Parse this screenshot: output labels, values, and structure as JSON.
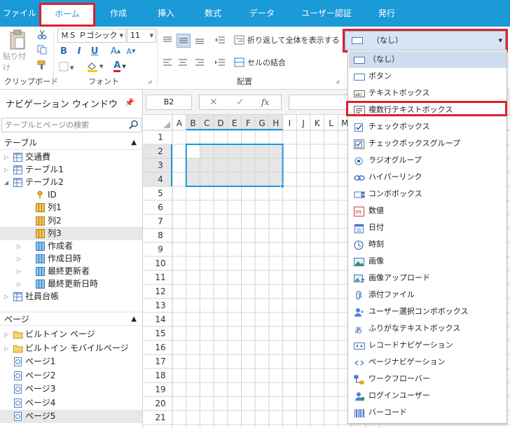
{
  "menu": {
    "items": [
      "ファイル",
      "ホーム",
      "作成",
      "挿入",
      "数式",
      "データ",
      "ユーザー認証",
      "発行"
    ],
    "active_index": 1
  },
  "ribbon": {
    "clipboard": {
      "paste_label": "貼り付け",
      "group_label": "クリップボード"
    },
    "font": {
      "family": "ＭＳ Ｐゴシック",
      "size": "11",
      "group_label": "フォント",
      "bold": "B",
      "italic": "I",
      "underline": "U",
      "grow": "A",
      "shrink": "A",
      "font_color_letter": "A"
    },
    "alignment": {
      "wrap_label": "折り返して全体を表示する",
      "merge_label": "セルの結合",
      "group_label": "配置"
    },
    "control_type": {
      "selected": "（なし）"
    }
  },
  "colors": {
    "accent": "#1a9ad6",
    "highlight_red": "#e0202a",
    "fill_yellow": "#f2d100",
    "font_red": "#e02020",
    "selection": "#cfdcf0"
  },
  "nav": {
    "title": "ナビゲーション ウィンドウ",
    "search_placeholder": "テーブルとページの検索",
    "tables_header": "テーブル",
    "pages_header": "ページ",
    "tables": [
      {
        "label": "交通費",
        "level": 0,
        "twisty": "▷",
        "icon": "table-icon"
      },
      {
        "label": "テーブル1",
        "level": 0,
        "twisty": "▷",
        "icon": "table-icon"
      },
      {
        "label": "テーブル2",
        "level": 0,
        "twisty": "◢",
        "icon": "table-icon"
      },
      {
        "label": "ID",
        "level": 1,
        "twisty": "",
        "icon": "key-icon"
      },
      {
        "label": "列1",
        "level": 1,
        "twisty": "",
        "icon": "column-icon"
      },
      {
        "label": "列2",
        "level": 1,
        "twisty": "",
        "icon": "column-icon"
      },
      {
        "label": "列3",
        "level": 1,
        "twisty": "",
        "icon": "column-icon",
        "selected": true
      },
      {
        "label": "作成者",
        "level": 1,
        "twisty": "▷",
        "icon": "system-column-icon"
      },
      {
        "label": "作成日時",
        "level": 1,
        "twisty": "▷",
        "icon": "system-column-icon"
      },
      {
        "label": "最終更新者",
        "level": 1,
        "twisty": "▷",
        "icon": "system-column-icon"
      },
      {
        "label": "最終更新日時",
        "level": 1,
        "twisty": "▷",
        "icon": "system-column-icon"
      },
      {
        "label": "社員台帳",
        "level": 0,
        "twisty": "▷",
        "icon": "table-icon"
      }
    ],
    "pages": [
      {
        "label": "ビルトイン ページ",
        "twisty": "▷",
        "icon": "folder-icon"
      },
      {
        "label": "ビルトイン モバイルページ",
        "twisty": "▷",
        "icon": "folder-icon"
      },
      {
        "label": "ページ1",
        "twisty": "",
        "icon": "page-icon"
      },
      {
        "label": "ページ2",
        "twisty": "",
        "icon": "page-icon"
      },
      {
        "label": "ページ3",
        "twisty": "",
        "icon": "page-icon"
      },
      {
        "label": "ページ4",
        "twisty": "",
        "icon": "page-icon"
      },
      {
        "label": "ページ5",
        "twisty": "",
        "icon": "page-icon",
        "selected": true
      }
    ]
  },
  "formula_bar": {
    "cell_ref": "B2",
    "cancel": "✕",
    "confirm": "✓",
    "fx": "fx"
  },
  "grid": {
    "columns": [
      "A",
      "B",
      "C",
      "D",
      "E",
      "F",
      "G",
      "H",
      "I",
      "J",
      "K",
      "L",
      "M"
    ],
    "rows": [
      "1",
      "2",
      "3",
      "4",
      "5",
      "6",
      "7",
      "8",
      "9",
      "10",
      "11",
      "12",
      "13",
      "14",
      "15",
      "16",
      "17",
      "18",
      "19",
      "20",
      "21"
    ]
  },
  "control_list": [
    {
      "label": "（なし）",
      "icon": "none-icon",
      "selected": true
    },
    {
      "label": "ボタン",
      "icon": "button-icon"
    },
    {
      "label": "テキストボックス",
      "icon": "textbox-icon"
    },
    {
      "label": "複数行テキストボックス",
      "icon": "multiline-textbox-icon",
      "highlighted": true
    },
    {
      "label": "チェックボックス",
      "icon": "checkbox-icon"
    },
    {
      "label": "チェックボックスグループ",
      "icon": "checkbox-group-icon"
    },
    {
      "label": "ラジオグループ",
      "icon": "radio-group-icon"
    },
    {
      "label": "ハイパーリンク",
      "icon": "hyperlink-icon"
    },
    {
      "label": "コンボボックス",
      "icon": "combobox-icon"
    },
    {
      "label": "数値",
      "icon": "number-icon"
    },
    {
      "label": "日付",
      "icon": "calendar-icon"
    },
    {
      "label": "時刻",
      "icon": "clock-icon"
    },
    {
      "label": "画像",
      "icon": "image-icon"
    },
    {
      "label": "画像アップロード",
      "icon": "image-upload-icon"
    },
    {
      "label": "添付ファイル",
      "icon": "attachment-icon"
    },
    {
      "label": "ユーザー選択コンボボックス",
      "icon": "user-select-icon"
    },
    {
      "label": "ふりがなテキストボックス",
      "icon": "furigana-icon"
    },
    {
      "label": "レコードナビゲーション",
      "icon": "record-nav-icon"
    },
    {
      "label": "ページナビゲーション",
      "icon": "page-nav-icon"
    },
    {
      "label": "ワークフローバー",
      "icon": "workflow-icon"
    },
    {
      "label": "ログインユーザー",
      "icon": "login-user-icon"
    },
    {
      "label": "バーコード",
      "icon": "barcode-icon"
    }
  ]
}
